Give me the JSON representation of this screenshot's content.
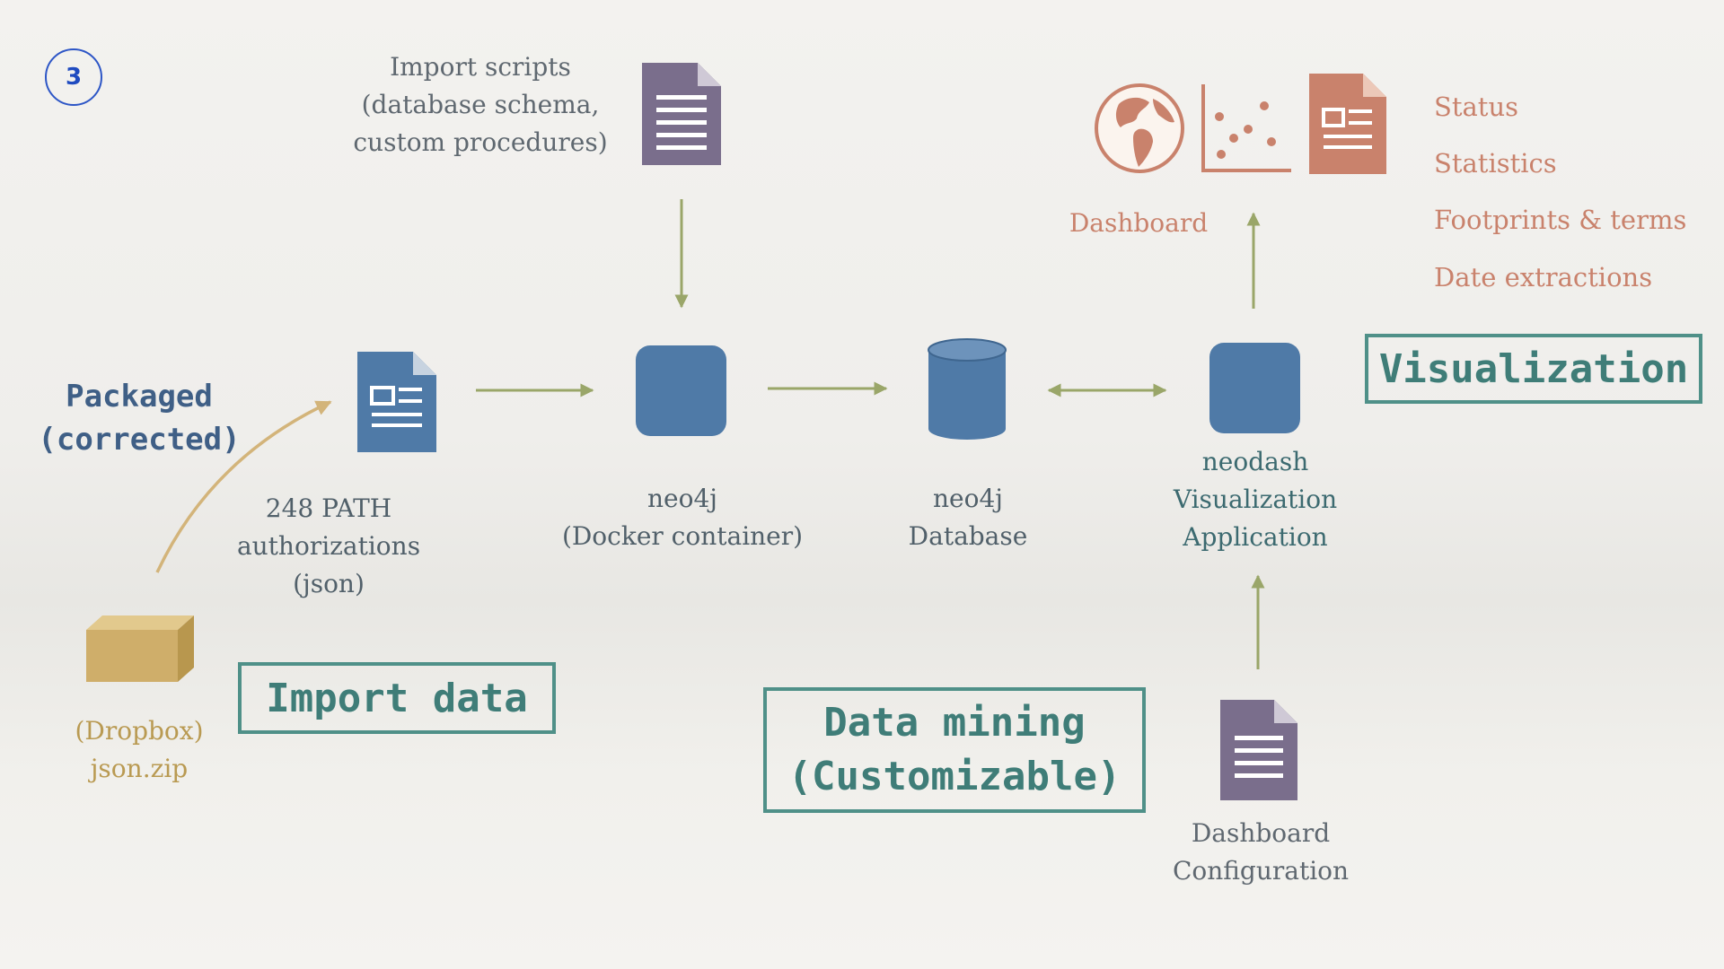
{
  "step_number": "3",
  "import_scripts": {
    "label": "Import scripts\n(database schema,\ncustom procedures)"
  },
  "packaged": {
    "label": "Packaged\n(corrected)"
  },
  "source": {
    "label": "(Dropbox)\njson.zip"
  },
  "authorizations": {
    "label": "248 PATH\nauthorizations\n(json)"
  },
  "import_data": {
    "label": "Import data"
  },
  "container": {
    "label": "neo4j\n(Docker container)"
  },
  "database": {
    "label": "neo4j\nDatabase"
  },
  "neodash": {
    "label": "neodash\nVisualization\nApplication"
  },
  "dashboard": {
    "label": "Dashboard"
  },
  "dashboard_items": [
    "Status",
    "Statistics",
    "Footprints & terms",
    "Date extractions"
  ],
  "visualization": {
    "label": "Visualization"
  },
  "data_mining": {
    "label": "Data mining\n(Customizable)"
  },
  "dashboard_config": {
    "label": "Dashboard\nConfiguration"
  },
  "colors": {
    "node_blue": "#4f7aa7",
    "doc_purple": "#7a6e8c",
    "arrow_green": "#9aa669",
    "accent_coral": "#c9826c",
    "box_teal": "#4f9088",
    "package_tan": "#cfae6a"
  },
  "icons": [
    "document-icon",
    "globe-icon",
    "scatter-plot-icon",
    "report-icon",
    "package-box-icon",
    "database-cylinder-icon"
  ]
}
